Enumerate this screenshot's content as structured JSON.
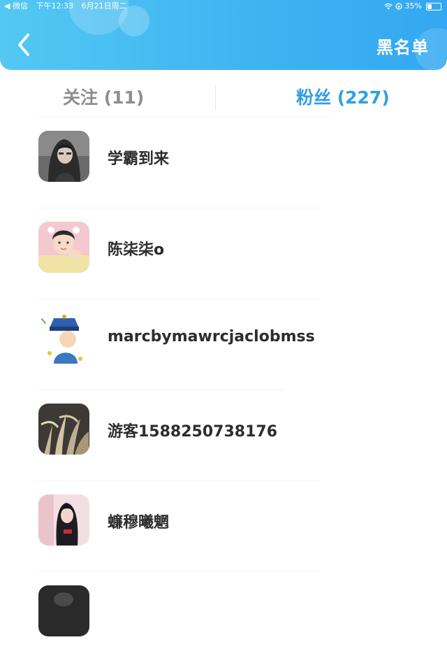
{
  "status_bar": {
    "app": "◀ 微信",
    "time": "下午12:33",
    "date": "6月21日周二",
    "battery": "35%",
    "battery_level": 0.35
  },
  "header": {
    "back_icon": "chevron-left-icon",
    "title": "黑名单",
    "accent_color": "#3fb4f2"
  },
  "tabs": [
    {
      "label": "关注 (11)",
      "active": false
    },
    {
      "label": "粉丝 (227)",
      "active": true
    }
  ],
  "users": [
    {
      "name": "学霸到来"
    },
    {
      "name": "陈柒柒o"
    },
    {
      "name": "marcbymawrcjaclobmss"
    },
    {
      "name": "游客1588250738176"
    },
    {
      "name": "蠊穆曦魍"
    },
    {
      "name": ""
    }
  ]
}
